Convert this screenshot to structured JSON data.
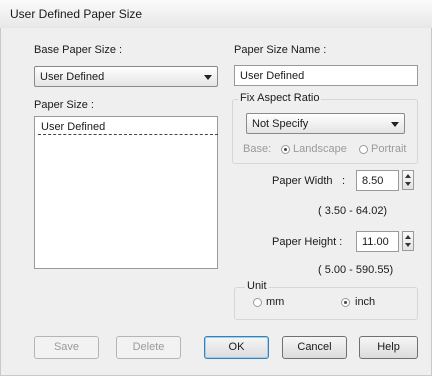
{
  "window": {
    "title": "User Defined Paper Size"
  },
  "base_paper_size": {
    "label": "Base Paper Size :",
    "value": "User Defined"
  },
  "paper_size": {
    "label": "Paper Size :",
    "items": [
      "User Defined"
    ]
  },
  "paper_size_name": {
    "label": "Paper Size Name :",
    "value": "User Defined"
  },
  "fix_aspect_ratio": {
    "label": "Fix Aspect Ratio",
    "value": "Not Specify",
    "base_label": "Base:",
    "landscape_label": "Landscape",
    "portrait_label": "Portrait",
    "landscape_selected": true
  },
  "paper_width": {
    "label": "Paper Width",
    "colon": ":",
    "value": "8.50",
    "range": "( 3.50 - 64.02)"
  },
  "paper_height": {
    "label": "Paper Height :",
    "value": "11.00",
    "range": "( 5.00 - 590.55)"
  },
  "unit": {
    "label": "Unit",
    "mm_label": "mm",
    "inch_label": "inch",
    "selected": "inch"
  },
  "buttons": {
    "save": "Save",
    "delete": "Delete",
    "ok": "OK",
    "cancel": "Cancel",
    "help": "Help"
  }
}
